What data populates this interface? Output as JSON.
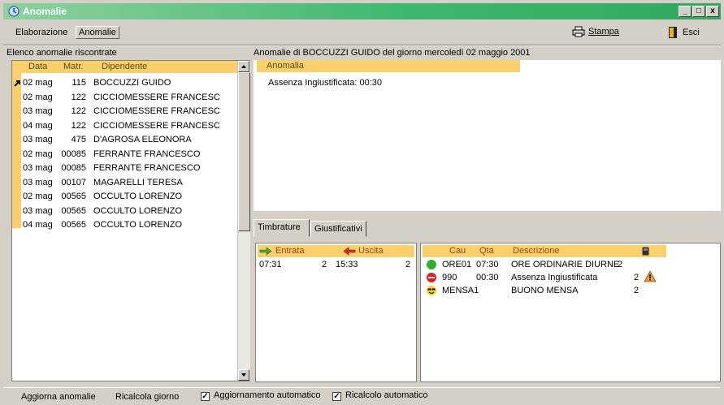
{
  "window": {
    "title": "Anomalie",
    "min": "_",
    "max": "□",
    "close": "x"
  },
  "menu": {
    "elaborazione": "Elaborazione",
    "anomalie": "Anomalie"
  },
  "toolbar": {
    "stampa": "Stampa",
    "esci": "Esci"
  },
  "left": {
    "title": "Elenco anomalie riscontrate",
    "columns": [
      "Data",
      "Matr.",
      "Dipendente"
    ],
    "rows": [
      {
        "data": "02 mag",
        "matr": "115",
        "dip": "BOCCUZZI GUIDO"
      },
      {
        "data": "02 mag",
        "matr": "122",
        "dip": "CICCIOMESSERE FRANCESC"
      },
      {
        "data": "03 mag",
        "matr": "122",
        "dip": "CICCIOMESSERE FRANCESC"
      },
      {
        "data": "04 mag",
        "matr": "122",
        "dip": "CICCIOMESSERE FRANCESC"
      },
      {
        "data": "03 mag",
        "matr": "475",
        "dip": "D'AGROSA ELEONORA"
      },
      {
        "data": "02 mag",
        "matr": "00085",
        "dip": "FERRANTE FRANCESCO"
      },
      {
        "data": "03 mag",
        "matr": "00085",
        "dip": "FERRANTE FRANCESCO"
      },
      {
        "data": "03 mag",
        "matr": "00107",
        "dip": "MAGARELLI TERESA"
      },
      {
        "data": "02 mag",
        "matr": "00565",
        "dip": "OCCULTO LORENZO"
      },
      {
        "data": "03 mag",
        "matr": "00565",
        "dip": "OCCULTO LORENZO"
      },
      {
        "data": "04 mag",
        "matr": "00565",
        "dip": "OCCULTO LORENZO"
      }
    ]
  },
  "right": {
    "title": "Anomalie di BOCCUZZI GUIDO del giorno mercoledì 02 maggio 2001",
    "column": "Anomalia",
    "item": "Assenza Ingiustificata: 00:30"
  },
  "tabs": {
    "timbrature": "Timbrature",
    "giustificativi": "Giustificativi"
  },
  "timbrature": {
    "entrata": "Entrata",
    "uscita": "Uscita",
    "row": {
      "in_time": "07:31",
      "in_n": "2",
      "out_time": "15:33",
      "out_n": "2"
    }
  },
  "giust": {
    "columns": {
      "cau": "Cau",
      "qta": "Qta",
      "descr": "Descrizione"
    },
    "rows": [
      {
        "cau": "ORE01",
        "qta": "07:30",
        "descr": "ORE ORDINARIE DIURNE",
        "n": "2"
      },
      {
        "cau": "990",
        "qta": "00:30",
        "descr": "Assenza Ingiustificata",
        "n": "2"
      },
      {
        "cau": "MENSA1",
        "qta": "",
        "descr": "BUONO MENSA",
        "n": "2"
      }
    ]
  },
  "status": {
    "aggiorna": "Aggiorna anomalie",
    "ricalcola": "Ricalcola giorno",
    "agg_auto": "Aggiornamento automatico",
    "ric_auto": "Ricalcolo automatico",
    "check": "✓"
  },
  "colors": {
    "header": "#fbd06a",
    "title_start": "#8fd0a0",
    "title_end": "#2fa860"
  }
}
